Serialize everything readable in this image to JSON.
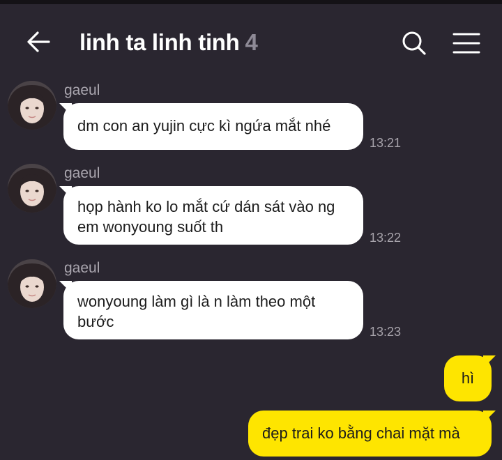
{
  "header": {
    "title": "linh ta linh tinh",
    "member_count": "4",
    "icons": {
      "back": "arrow-left-icon",
      "search": "search-icon",
      "menu": "hamburger-menu-icon"
    }
  },
  "colors": {
    "background": "#2a2630",
    "incoming_bubble": "#ffffff",
    "outgoing_bubble": "#fee500",
    "muted_text": "#a9a5ae"
  },
  "messages": [
    {
      "sender": "gaeul",
      "text": "dm con an yujin cực kì ngứa mắt nhé",
      "time": "13:21"
    },
    {
      "sender": "gaeul",
      "text": "họp hành ko lo mắt cứ dán sát vào ng em wonyoung suốt th",
      "time": "13:22"
    },
    {
      "sender": "gaeul",
      "text": "wonyoung làm gì là n làm theo một bước",
      "time": "13:23"
    }
  ],
  "outgoing": [
    {
      "text": "hì"
    },
    {
      "text": "đẹp trai ko bằng chai mặt mà"
    }
  ]
}
